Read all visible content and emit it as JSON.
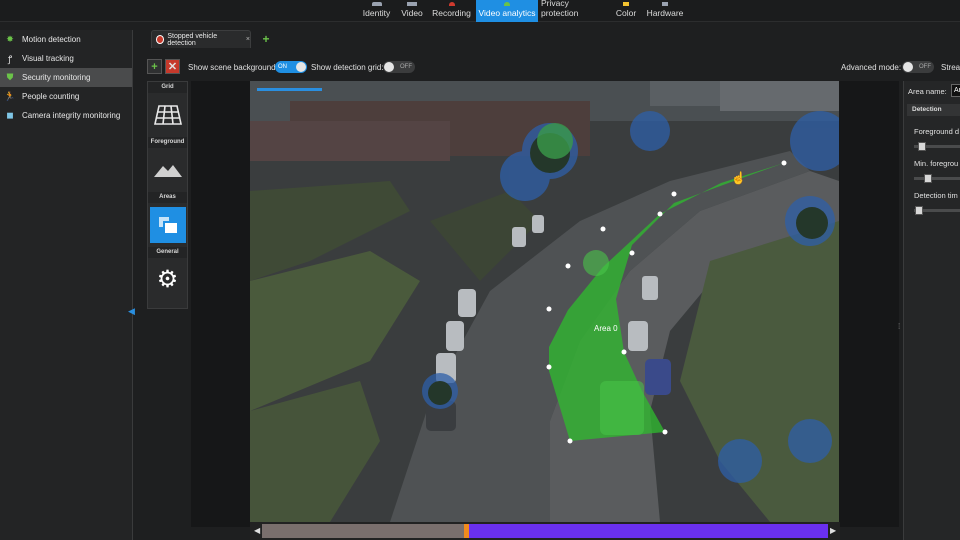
{
  "ribbon": {
    "items": [
      {
        "label": "Identity",
        "color": "#9aa2b0"
      },
      {
        "label": "Video",
        "color": "#9aa2b0"
      },
      {
        "label": "Recording",
        "color": "#d03a2e"
      },
      {
        "label": "Video analytics",
        "color": "#6bc349",
        "active": true
      },
      {
        "label": "Privacy protection",
        "color": "#9aa2b0"
      },
      {
        "label": "Color",
        "color": "#f2c230"
      },
      {
        "label": "Hardware",
        "color": "#9aa2b0"
      }
    ]
  },
  "sidebar": {
    "items": [
      {
        "label": "Motion detection",
        "icon": "motion-icon"
      },
      {
        "label": "Visual tracking",
        "icon": "tracking-icon"
      },
      {
        "label": "Security monitoring",
        "icon": "shield-icon",
        "active": true
      },
      {
        "label": "People counting",
        "icon": "person-icon"
      },
      {
        "label": "Camera integrity monitoring",
        "icon": "camera-icon"
      }
    ]
  },
  "tabs": {
    "active_label": "Stopped vehicle detection",
    "add_symbol": "+",
    "close_symbol": "×"
  },
  "toolbar": {
    "add_symbol": "+",
    "remove_symbol": "✕",
    "scene_background_label": "Show scene background:",
    "scene_background_state": "ON",
    "detection_grid_label": "Show detection grid:",
    "detection_grid_state": "OFF",
    "advanced_mode_label": "Advanced mode:",
    "advanced_mode_state": "OFF",
    "stream_label": "Strea"
  },
  "palette": {
    "sections": [
      "Grid",
      "Foreground",
      "Areas",
      "General"
    ]
  },
  "video": {
    "area_label": "Area 0"
  },
  "timeline": {
    "left_arrow": "◀",
    "right_arrow": "▶",
    "position": 0.36
  },
  "right_panel": {
    "area_name_label": "Area name:",
    "area_name_value": "Ar",
    "section_title": "Detection",
    "foreground_label": "Foreground d",
    "min_foreground_label": "Min. foregrou",
    "detection_time_label": "Detection tim"
  },
  "colors": {
    "accent": "#1f8fe3",
    "area_fill": "#2fb82f",
    "timeline_fill": "#6a30ef",
    "timeline_marker": "#f08b1e"
  }
}
